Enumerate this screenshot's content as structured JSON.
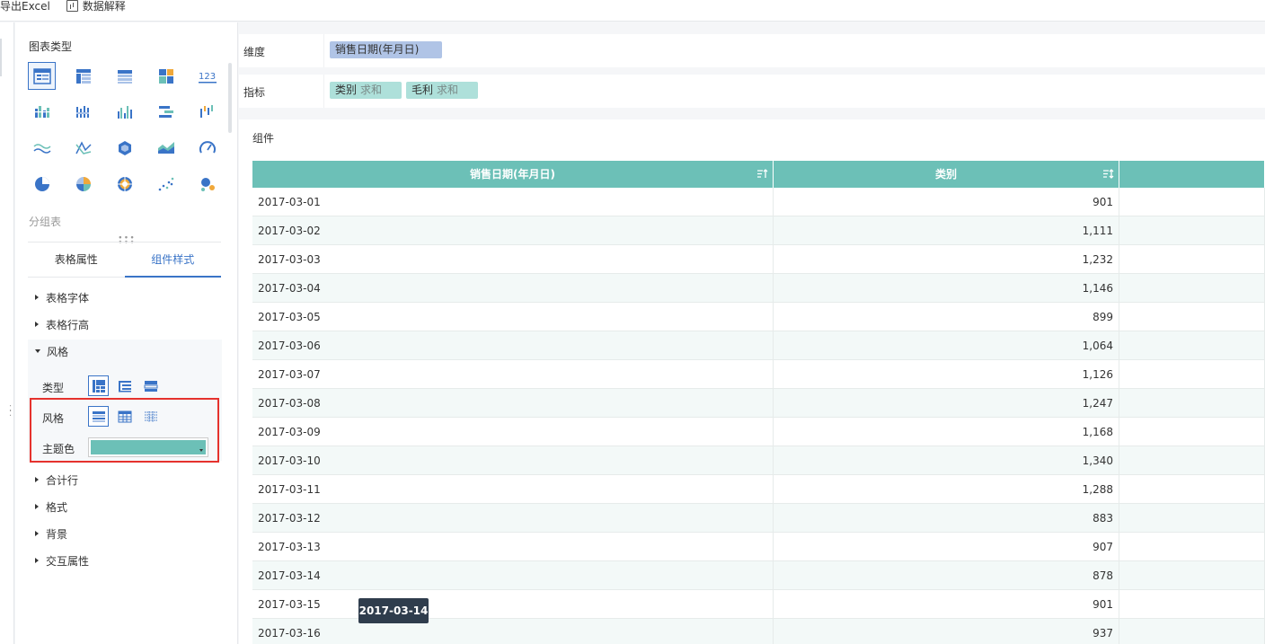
{
  "toolbar": {
    "export_label": "导出Excel",
    "explain_label": "数据解释"
  },
  "left_panel": {
    "chart_type_title": "图表类型",
    "chart_types": [
      "group-table-icon",
      "cross-table-icon",
      "detail-table-icon",
      "treemap-icon",
      "kpi-number-icon",
      "multi-bar-icon",
      "stacked-bar-icon",
      "column-chart-icon",
      "bar-range-icon",
      "waterfall-icon",
      "line-chart-icon",
      "radar-line-icon",
      "polygon-icon",
      "area-chart-icon",
      "gauge-icon",
      "pie-chart-icon",
      "rose-pie-icon",
      "multi-pie-icon",
      "scatter-icon",
      "bubble-icon"
    ],
    "selected_chart_label": "分组表",
    "tabs": [
      "表格属性",
      "组件样式"
    ],
    "active_tab": "组件样式",
    "sections": {
      "table_font": "表格字体",
      "row_height": "表格行高",
      "style": "风格",
      "total_row": "合计行",
      "format": "格式",
      "background": "背景",
      "interaction": "交互属性"
    },
    "style_box": {
      "type_label": "类型",
      "style_label": "风格",
      "theme_color_label": "主题色",
      "theme_color": "#6cc0b7"
    }
  },
  "dimension_bar": {
    "label": "维度",
    "field": "销售日期(年月日)"
  },
  "metric_bar": {
    "label": "指标",
    "fields": [
      {
        "name": "类别",
        "agg": "求和"
      },
      {
        "name": "毛利",
        "agg": "求和"
      }
    ]
  },
  "canvas": {
    "title": "组件",
    "accent_color": "#6cc0b7",
    "columns": [
      "销售日期(年月日)",
      "类别",
      ""
    ],
    "rows": [
      [
        "2017-03-01",
        "901"
      ],
      [
        "2017-03-02",
        "1,111"
      ],
      [
        "2017-03-03",
        "1,232"
      ],
      [
        "2017-03-04",
        "1,146"
      ],
      [
        "2017-03-05",
        "899"
      ],
      [
        "2017-03-06",
        "1,064"
      ],
      [
        "2017-03-07",
        "1,126"
      ],
      [
        "2017-03-08",
        "1,247"
      ],
      [
        "2017-03-09",
        "1,168"
      ],
      [
        "2017-03-10",
        "1,340"
      ],
      [
        "2017-03-11",
        "1,288"
      ],
      [
        "2017-03-12",
        "883"
      ],
      [
        "2017-03-13",
        "907"
      ],
      [
        "2017-03-14",
        "878"
      ],
      [
        "2017-03-15",
        "901"
      ],
      [
        "2017-03-16",
        "937"
      ]
    ],
    "tooltip": "2017-03-14"
  }
}
